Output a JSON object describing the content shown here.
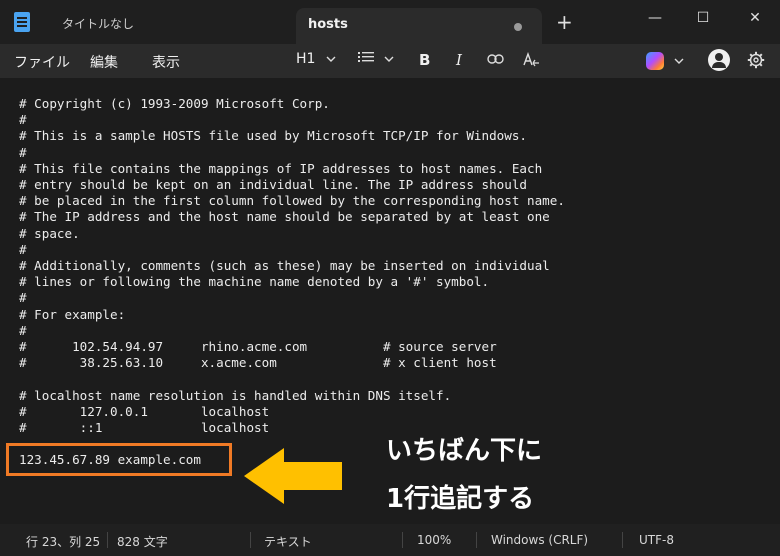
{
  "tabs": {
    "untitled": "タイトルなし",
    "active": "hosts",
    "new": "+"
  },
  "window": {
    "minimize": "—",
    "maximize": "☐",
    "close": "✕"
  },
  "menu": {
    "file": "ファイル",
    "edit": "編集",
    "view": "表示"
  },
  "toolbar": {
    "heading": "H1",
    "bold": "B",
    "italic": "I"
  },
  "content": {
    "lines": [
      "# Copyright (c) 1993-2009 Microsoft Corp.",
      "#",
      "# This is a sample HOSTS file used by Microsoft TCP/IP for Windows.",
      "#",
      "# This file contains the mappings of IP addresses to host names. Each",
      "# entry should be kept on an individual line. The IP address should",
      "# be placed in the first column followed by the corresponding host name.",
      "# The IP address and the host name should be separated by at least one",
      "# space.",
      "#",
      "# Additionally, comments (such as these) may be inserted on individual",
      "# lines or following the machine name denoted by a '#' symbol.",
      "#",
      "# For example:",
      "#",
      "#      102.54.94.97     rhino.acme.com          # source server",
      "#       38.25.63.10     x.acme.com              # x client host",
      "",
      "# localhost name resolution is handled within DNS itself.",
      "#       127.0.0.1       localhost",
      "#       ::1             localhost"
    ],
    "new_line": "123.45.67.89 example.com"
  },
  "annotation": {
    "line1": "いちばん下に",
    "line2": "1行追記する",
    "arrow_color": "#ffc000",
    "box_color": "#f07a25"
  },
  "status": {
    "position": "行 23、列 25",
    "chars": "828 文字",
    "format": "テキスト",
    "zoom": "100%",
    "eol": "Windows (CRLF)",
    "encoding": "UTF-8"
  }
}
